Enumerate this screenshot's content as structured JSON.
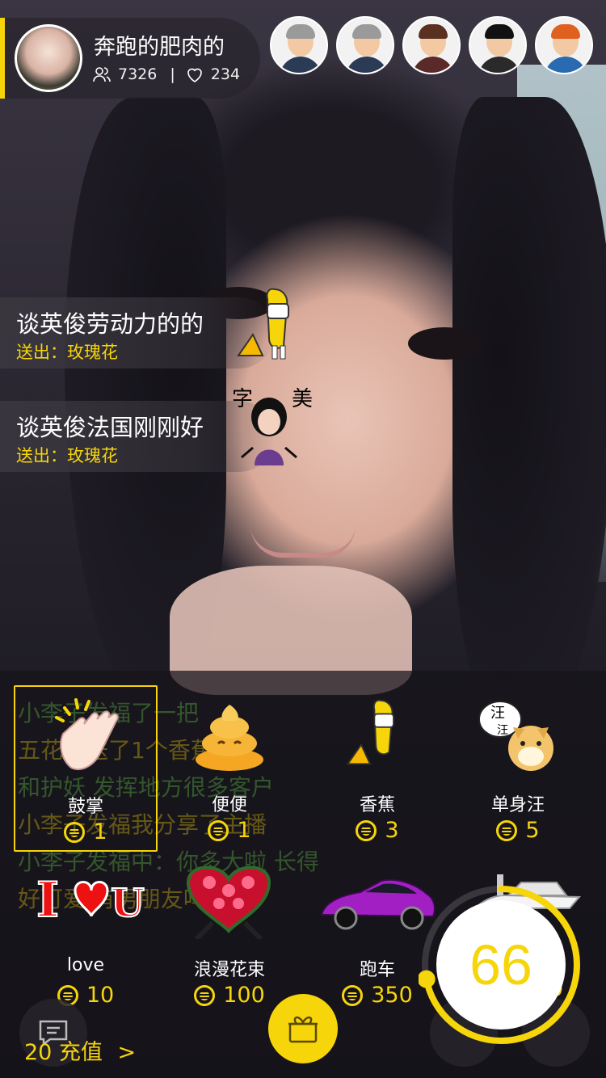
{
  "anchor": {
    "name": "奔跑的肥肉的",
    "followers": "7326",
    "separator": "|",
    "likes": "234"
  },
  "viewers": [
    {
      "icon": "businessman-avatar-icon",
      "shirt": "#2b3a55",
      "hair": "#9a9a9a"
    },
    {
      "icon": "businessman-avatar-icon",
      "shirt": "#2b3a55",
      "hair": "#9a9a9a"
    },
    {
      "icon": "woman-avatar-icon",
      "shirt": "#5a2a2a",
      "hair": "#5a3020"
    },
    {
      "icon": "pirate-avatar-icon",
      "shirt": "#2a2a2a",
      "hair": "#111111"
    },
    {
      "icon": "redhead-avatar-icon",
      "shirt": "#2a6ab0",
      "hair": "#e06020"
    }
  ],
  "notifications": [
    {
      "user": "谈英俊劳动力的的",
      "sent": "送出：玫瑰花",
      "icon": "banana-icon"
    },
    {
      "user": "谈英俊法国刚刚好",
      "sent": "送出：玫瑰花",
      "icon": "beauty-lady-icon"
    }
  ],
  "chat_background": [
    "小李子发福了一把",
    "五花肉送了1个香蕉",
    "和护妖  发挥地方很多客户",
    "小李子发福我分享了主播",
    "小李子发福中：你多大啦 长得",
    "好可爱  有男朋友吗啊～"
  ],
  "gifts": [
    {
      "name": "鼓掌",
      "price": "1",
      "icon": "clapping-hands-icon",
      "selected": true
    },
    {
      "name": "便便",
      "price": "1",
      "icon": "poop-icon",
      "selected": false
    },
    {
      "name": "香蕉",
      "price": "3",
      "icon": "banana-icon",
      "selected": false
    },
    {
      "name": "单身汪",
      "price": "5",
      "icon": "single-dog-icon",
      "selected": false
    },
    {
      "name": "love",
      "price": "10",
      "icon": "i-love-u-icon",
      "selected": false
    },
    {
      "name": "浪漫花束",
      "price": "100",
      "icon": "rose-bouquet-icon",
      "selected": false
    },
    {
      "name": "跑车",
      "price": "350",
      "icon": "sports-car-icon",
      "selected": false
    }
  ],
  "hidden_gift_price_fragment": "0",
  "recharge": {
    "balance": "20",
    "label": "充值",
    "arrow": ">"
  },
  "countdown": {
    "value": "66",
    "progress": 0.72
  },
  "colors": {
    "accent": "#f6d50b",
    "panel": "rgba(22,20,26,0.72)"
  }
}
